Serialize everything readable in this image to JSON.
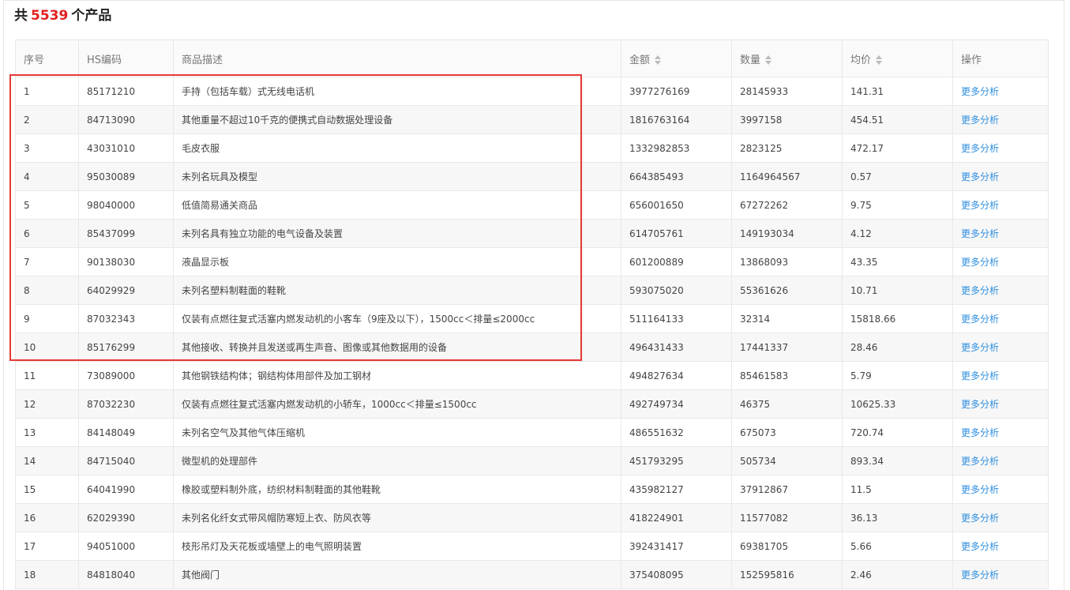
{
  "summary": {
    "prefix": "共",
    "count": "5539",
    "suffix": "个产品"
  },
  "columns": {
    "index": "序号",
    "hs_code": "HS编码",
    "description": "商品描述",
    "amount": "金额",
    "quantity": "数量",
    "avg_price": "均价",
    "action": "操作"
  },
  "rows": [
    {
      "index": "1",
      "hs_code": "85171210",
      "description": "手持（包括车载）式无线电话机",
      "amount": "3977276169",
      "quantity": "28145933",
      "avg_price": "141.31",
      "action": "更多分析"
    },
    {
      "index": "2",
      "hs_code": "84713090",
      "description": "其他重量不超过10千克的便携式自动数据处理设备",
      "amount": "1816763164",
      "quantity": "3997158",
      "avg_price": "454.51",
      "action": "更多分析"
    },
    {
      "index": "3",
      "hs_code": "43031010",
      "description": "毛皮衣服",
      "amount": "1332982853",
      "quantity": "2823125",
      "avg_price": "472.17",
      "action": "更多分析"
    },
    {
      "index": "4",
      "hs_code": "95030089",
      "description": "未列名玩具及模型",
      "amount": "664385493",
      "quantity": "1164964567",
      "avg_price": "0.57",
      "action": "更多分析"
    },
    {
      "index": "5",
      "hs_code": "98040000",
      "description": "低值简易通关商品",
      "amount": "656001650",
      "quantity": "67272262",
      "avg_price": "9.75",
      "action": "更多分析"
    },
    {
      "index": "6",
      "hs_code": "85437099",
      "description": "未列名具有独立功能的电气设备及装置",
      "amount": "614705761",
      "quantity": "149193034",
      "avg_price": "4.12",
      "action": "更多分析"
    },
    {
      "index": "7",
      "hs_code": "90138030",
      "description": "液晶显示板",
      "amount": "601200889",
      "quantity": "13868093",
      "avg_price": "43.35",
      "action": "更多分析"
    },
    {
      "index": "8",
      "hs_code": "64029929",
      "description": "未列名塑料制鞋面的鞋靴",
      "amount": "593075020",
      "quantity": "55361626",
      "avg_price": "10.71",
      "action": "更多分析"
    },
    {
      "index": "9",
      "hs_code": "87032343",
      "description": "仅装有点燃往复式活塞内燃发动机的小客车（9座及以下），1500cc＜排量≤2000cc",
      "amount": "511164133",
      "quantity": "32314",
      "avg_price": "15818.66",
      "action": "更多分析"
    },
    {
      "index": "10",
      "hs_code": "85176299",
      "description": "其他接收、转换并且发送或再生声音、图像或其他数据用的设备",
      "amount": "496431433",
      "quantity": "17441337",
      "avg_price": "28.46",
      "action": "更多分析"
    },
    {
      "index": "11",
      "hs_code": "73089000",
      "description": "其他钢铁结构体；钢结构体用部件及加工钢材",
      "amount": "494827634",
      "quantity": "85461583",
      "avg_price": "5.79",
      "action": "更多分析"
    },
    {
      "index": "12",
      "hs_code": "87032230",
      "description": "仅装有点燃往复式活塞内燃发动机的小轿车，1000cc＜排量≤1500cc",
      "amount": "492749734",
      "quantity": "46375",
      "avg_price": "10625.33",
      "action": "更多分析"
    },
    {
      "index": "13",
      "hs_code": "84148049",
      "description": "未列名空气及其他气体压缩机",
      "amount": "486551632",
      "quantity": "675073",
      "avg_price": "720.74",
      "action": "更多分析"
    },
    {
      "index": "14",
      "hs_code": "84715040",
      "description": "微型机的处理部件",
      "amount": "451793295",
      "quantity": "505734",
      "avg_price": "893.34",
      "action": "更多分析"
    },
    {
      "index": "15",
      "hs_code": "64041990",
      "description": "橡胶或塑料制外底，纺织材料制鞋面的其他鞋靴",
      "amount": "435982127",
      "quantity": "37912867",
      "avg_price": "11.5",
      "action": "更多分析"
    },
    {
      "index": "16",
      "hs_code": "62029390",
      "description": "未列名化纤女式带风帽防寒短上衣、防风衣等",
      "amount": "418224901",
      "quantity": "11577082",
      "avg_price": "36.13",
      "action": "更多分析"
    },
    {
      "index": "17",
      "hs_code": "94051000",
      "description": "枝形吊灯及天花板或墙壁上的电气照明装置",
      "amount": "392431417",
      "quantity": "69381705",
      "avg_price": "5.66",
      "action": "更多分析"
    },
    {
      "index": "18",
      "hs_code": "84818040",
      "description": "其他阀门",
      "amount": "375408095",
      "quantity": "152595816",
      "avg_price": "2.46",
      "action": "更多分析"
    }
  ],
  "colors": {
    "accent_count": "#e02020",
    "link": "#2f8fe0",
    "highlight_border": "#e53935"
  }
}
